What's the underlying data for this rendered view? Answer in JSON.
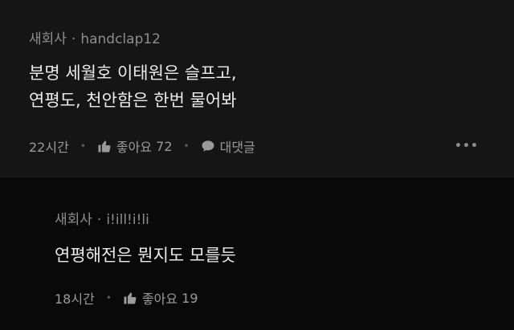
{
  "comments": [
    {
      "source": "새회사",
      "separator": "·",
      "author": "handclap12",
      "lines": [
        "분명 세월호 이태원은 슬프고,",
        "연평도, 천안함은 한번 물어봐"
      ],
      "time": "22시간",
      "like_label": "좋아요",
      "like_count": "72",
      "reply_label": "대댓글",
      "like_icon": "thumbs-up-icon",
      "reply_icon": "speech-bubble-icon",
      "more_icon": "more-dots-icon"
    },
    {
      "source": "새회사",
      "separator": "·",
      "author": "i!ill!i!li",
      "lines": [
        "연평해전은 뭔지도 모를듯"
      ],
      "time": "18시간",
      "like_label": "좋아요",
      "like_count": "19",
      "like_icon": "thumbs-up-icon"
    }
  ],
  "colors": {
    "background": "#000000",
    "top_comment_bg": "#151515",
    "reply_bg": "#090909",
    "meta_text": "#8e8e8e",
    "body_text": "#ececec"
  }
}
